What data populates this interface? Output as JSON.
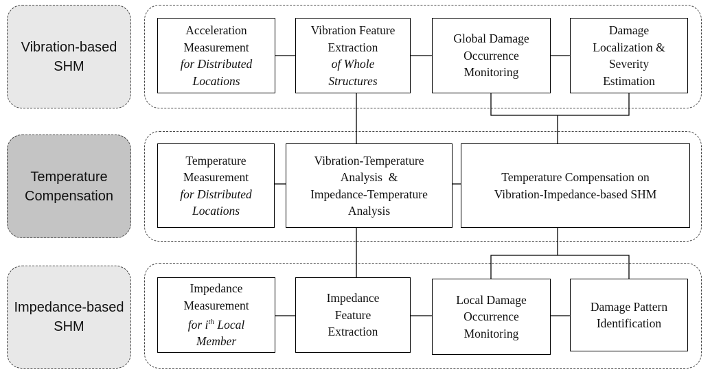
{
  "categories": [
    {
      "line1": "Vibration-based",
      "line2": "SHM",
      "fill": "#e8e8e8"
    },
    {
      "line1": "Temperature",
      "line2": "Compensation",
      "fill": "#c4c4c4"
    },
    {
      "line1": "Impedance-based",
      "line2": "SHM",
      "fill": "#e8e8e8"
    }
  ],
  "vibration": {
    "accel": {
      "l1": "Acceleration",
      "l2": "Measurement",
      "l3": "for Distributed",
      "l4": "Locations"
    },
    "feature": {
      "l1": "Vibration Feature",
      "l2": "Extraction",
      "l3": "of Whole",
      "l4": "Structures"
    },
    "global": {
      "l1": "Global Damage",
      "l2": "Occurrence",
      "l3": "Monitoring"
    },
    "local": {
      "l1": "Damage",
      "l2": "Localization &",
      "l3": "Severity",
      "l4": "Estimation"
    }
  },
  "temperature": {
    "measure": {
      "l1": "Temperature",
      "l2": "Measurement",
      "l3": "for Distributed",
      "l4": "Locations"
    },
    "analysis": {
      "l1": "Vibration-Temperature",
      "l2": "Analysis  &",
      "l3": "Impedance-Temperature",
      "l4": "Analysis"
    },
    "comp": {
      "l1": "Temperature Compensation on",
      "l2": "Vibration-Impedance-based SHM"
    }
  },
  "impedance": {
    "measure": {
      "l1": "Impedance",
      "l2": "Measurement",
      "l3a": "for i",
      "l3sup": "th",
      "l3b": " Local",
      "l4": "Member"
    },
    "feature": {
      "l1": "Impedance",
      "l2": "Feature",
      "l3": "Extraction"
    },
    "local": {
      "l1": "Local Damage",
      "l2": "Occurrence",
      "l3": "Monitoring"
    },
    "pattern": {
      "l1": "Damage Pattern",
      "l2": "Identification"
    }
  }
}
